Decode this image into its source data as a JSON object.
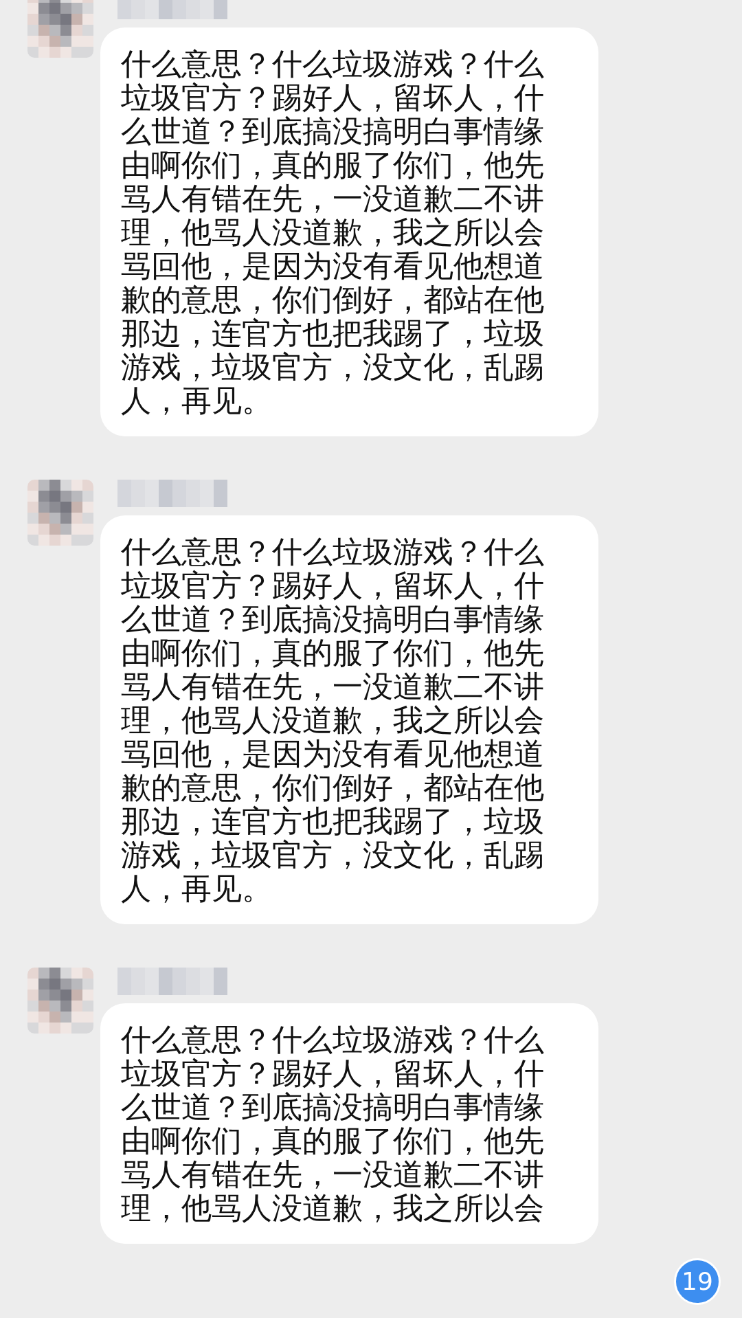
{
  "messages": [
    {
      "text": "什么意思？什么垃圾游戏？什么垃圾官方？踢好人，留坏人，什么世道？到底搞没搞明白事情缘由啊你们，真的服了你们，他先骂人有错在先，一没道歉二不讲理，他骂人没道歉，我之所以会骂回他，是因为没有看见他想道歉的意思，你们倒好，都站在他那边，连官方也把我踢了，垃圾游戏，垃圾官方，没文化，乱踢人，再见。"
    },
    {
      "text": "什么意思？什么垃圾游戏？什么垃圾官方？踢好人，留坏人，什么世道？到底搞没搞明白事情缘由啊你们，真的服了你们，他先骂人有错在先，一没道歉二不讲理，他骂人没道歉，我之所以会骂回他，是因为没有看见他想道歉的意思，你们倒好，都站在他那边，连官方也把我踢了，垃圾游戏，垃圾官方，没文化，乱踢人，再见。"
    },
    {
      "text": "什么意思？什么垃圾游戏？什么垃圾官方？踢好人，留坏人，什么世道？到底搞没搞明白事情缘由啊你们，真的服了你们，他先骂人有错在先，一没道歉二不讲理，他骂人没道歉，我之所以会"
    }
  ],
  "unread_badge": "19"
}
